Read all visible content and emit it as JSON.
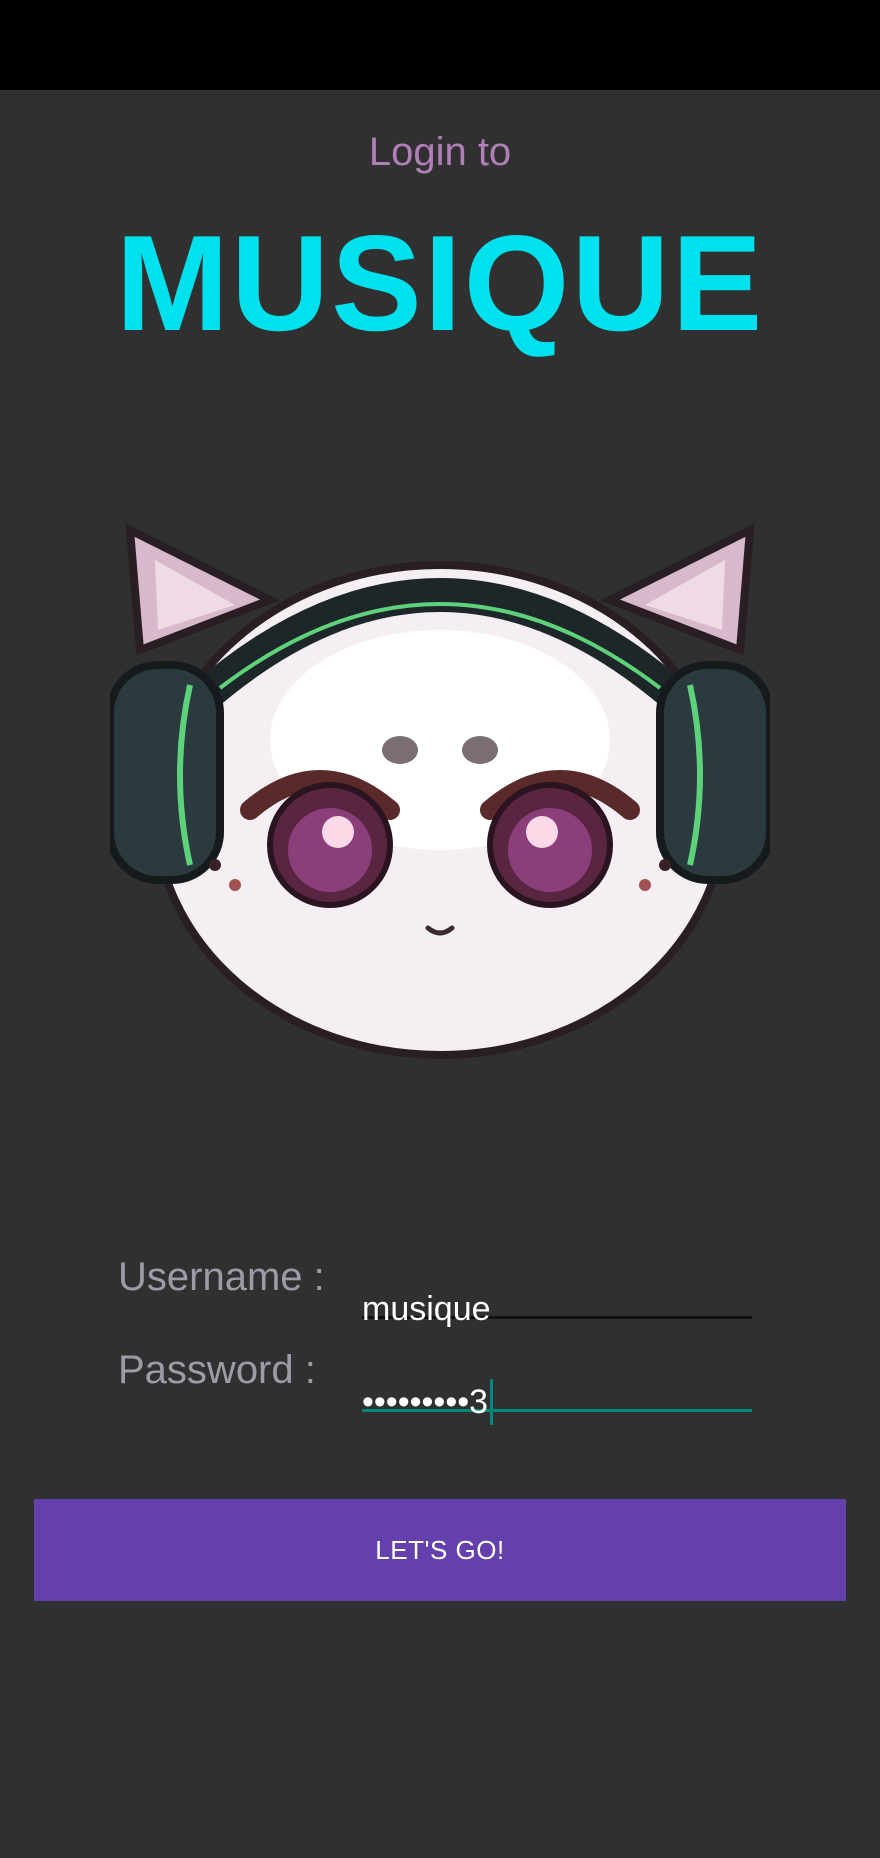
{
  "header": {
    "subtitle": "Login to",
    "title": "MUSIQUE"
  },
  "mascot": {
    "icon": "cat-with-headphones-logo",
    "colors": {
      "face": "#f5eef3",
      "headphones": "#2b3a3e",
      "headphone_accent": "#5ed27a",
      "eyes": "#5a2540"
    }
  },
  "form": {
    "username_label": "Username :",
    "username_value": "musique",
    "password_label": "Password :",
    "password_value": "•••••••••3"
  },
  "actions": {
    "submit_label": "LET'S GO!"
  },
  "colors": {
    "background": "#303030",
    "title": "#00e1ee",
    "subtitle": "#b07fb8",
    "button": "#6340ac",
    "focus_underline": "#00897b"
  }
}
